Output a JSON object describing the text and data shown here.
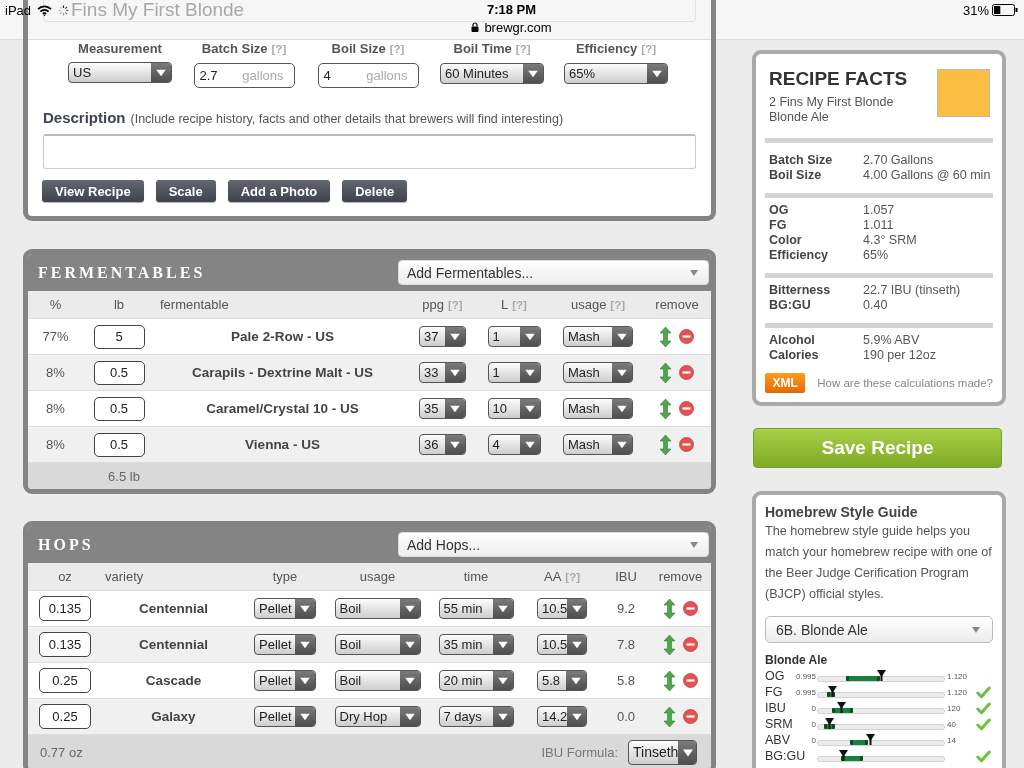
{
  "status_bar": {
    "device": "iPad",
    "time": "7:18 PM",
    "url": "brewgr.com",
    "battery": "31%"
  },
  "recipe_name": {
    "value": "Fins My First Blonde"
  },
  "settings": [
    {
      "label": "Measurement",
      "kind": "select",
      "value": "US"
    },
    {
      "label": "Batch Size",
      "help": "[?]",
      "kind": "input",
      "value": "2.7",
      "unit": "gallons"
    },
    {
      "label": "Boil Size",
      "help": "[?]",
      "kind": "input",
      "value": "4",
      "unit": "gallons"
    },
    {
      "label": "Boil Time",
      "help": "[?]",
      "kind": "select",
      "value": "60 Minutes"
    },
    {
      "label": "Efficiency",
      "help": "[?]",
      "kind": "select",
      "value": "65%"
    }
  ],
  "description": {
    "label": "Description",
    "hint": "(Include recipe history, facts and other details that brewers will find interesting)"
  },
  "actions": [
    "View Recipe",
    "Scale",
    "Add a Photo",
    "Delete"
  ],
  "fermentables": {
    "title": "FERMENTABLES",
    "add_select": "Add Fermentables...",
    "columns": [
      {
        "label": "%"
      },
      {
        "label": "lb"
      },
      {
        "label": "fermentable"
      },
      {
        "label": "ppg",
        "help": "[?]"
      },
      {
        "label": "L",
        "help": "[?]"
      },
      {
        "label": "usage",
        "help": "[?]"
      },
      {
        "label": "remove"
      }
    ],
    "rows": [
      {
        "percent": "77%",
        "amount": "5",
        "name": "Pale 2-Row - US",
        "ppg": "37",
        "lovibond": "1",
        "usage": "Mash"
      },
      {
        "percent": "8%",
        "amount": "0.5",
        "name": "Carapils - Dextrine Malt - US",
        "ppg": "33",
        "lovibond": "1",
        "usage": "Mash"
      },
      {
        "percent": "8%",
        "amount": "0.5",
        "name": "Caramel/Crystal 10 - US",
        "ppg": "35",
        "lovibond": "10",
        "usage": "Mash"
      },
      {
        "percent": "8%",
        "amount": "0.5",
        "name": "Vienna - US",
        "ppg": "36",
        "lovibond": "4",
        "usage": "Mash"
      }
    ],
    "total": "6.5 lb"
  },
  "hops": {
    "title": "HOPS",
    "add_select": "Add Hops...",
    "columns": [
      {
        "label": "oz"
      },
      {
        "label": "variety"
      },
      {
        "label": "type"
      },
      {
        "label": "usage"
      },
      {
        "label": "time"
      },
      {
        "label": "AA",
        "help": "[?]"
      },
      {
        "label": "IBU"
      },
      {
        "label": "remove"
      }
    ],
    "rows": [
      {
        "amount": "0.135",
        "variety": "Centennial",
        "type": "Pellet",
        "usage": "Boil",
        "time": "55 min",
        "aa": "10.5",
        "ibu": "9.2"
      },
      {
        "amount": "0.135",
        "variety": "Centennial",
        "type": "Pellet",
        "usage": "Boil",
        "time": "35 min",
        "aa": "10.5",
        "ibu": "7.8"
      },
      {
        "amount": "0.25",
        "variety": "Cascade",
        "type": "Pellet",
        "usage": "Boil",
        "time": "20 min",
        "aa": "5.8",
        "ibu": "5.8"
      },
      {
        "amount": "0.25",
        "variety": "Galaxy",
        "type": "Pellet",
        "usage": "Dry Hop",
        "time": "7 days",
        "aa": "14.2",
        "ibu": "0.0"
      }
    ],
    "total": "0.77 oz",
    "ibu_formula": {
      "label": "IBU Formula:",
      "value": "Tinseth"
    }
  },
  "recipe_facts": {
    "title": "RECIPE FACTS",
    "name": "2 Fins My First Blonde",
    "style": "Blonde Ale",
    "color": "#fbbe43",
    "groups": [
      [
        {
          "label": "Batch Size",
          "value": "2.70 Gallons"
        },
        {
          "label": "Boil Size",
          "value": "4.00 Gallons @ 60 min"
        }
      ],
      [
        {
          "label": "OG",
          "value": "1.057"
        },
        {
          "label": "FG",
          "value": "1.011"
        },
        {
          "label": "Color",
          "value": "4.3° SRM"
        },
        {
          "label": "Efficiency",
          "value": "65%"
        }
      ],
      [
        {
          "label": "Bitterness",
          "value": "22.7 IBU (tinseth)"
        },
        {
          "label": "BG:GU",
          "value": "0.40"
        }
      ],
      [
        {
          "label": "Alcohol",
          "value": "5.9% ABV"
        },
        {
          "label": "Calories",
          "value": "190 per 12oz"
        }
      ]
    ],
    "xml_button": "XML",
    "help_link": "How are these calculations made?"
  },
  "save_button": "Save Recipe",
  "style_guide": {
    "title": "Homebrew Style Guide",
    "text": "The homebrew style guide helps you match your homebrew recipe with one of the Beer Judge Cerification Program (BJCP) official styles.",
    "style_select": "6B. Blonde Ale",
    "style_name": "Blonde Ale",
    "ranges": [
      {
        "label": "OG",
        "min": "0.995",
        "max": "1.120",
        "style_min": {
          "level": 0.24
        },
        "style_max": {
          "level": 0.48
        },
        "recipe": {
          "level": 0.5
        },
        "in_range": false
      },
      {
        "label": "FG",
        "min": "0.995",
        "max": "1.120",
        "style_min": {
          "level": 0.09
        },
        "style_max": {
          "level": 0.13
        },
        "recipe": {
          "level": 0.12
        },
        "in_range": true
      },
      {
        "label": "IBU",
        "min": "0",
        "max": "120",
        "style_min": {
          "level": 0.13
        },
        "style_max": {
          "level": 0.27
        },
        "recipe": {
          "level": 0.19
        },
        "in_range": true
      },
      {
        "label": "SRM",
        "min": "0",
        "max": "40",
        "style_min": {
          "level": 0.07
        },
        "style_max": {
          "level": 0.13
        },
        "recipe": {
          "level": 0.1
        },
        "in_range": true
      },
      {
        "label": "ABV",
        "min": "0",
        "max": "14",
        "style_min": {
          "level": 0.27
        },
        "style_max": {
          "level": 0.39
        },
        "recipe": {
          "level": 0.42
        },
        "in_range": false
      },
      {
        "label": "BG:GU",
        "style_min": {
          "level": 0.2
        },
        "style_max": {
          "level": 0.35
        },
        "recipe": {
          "level": 0.21
        },
        "in_range": true
      }
    ]
  }
}
